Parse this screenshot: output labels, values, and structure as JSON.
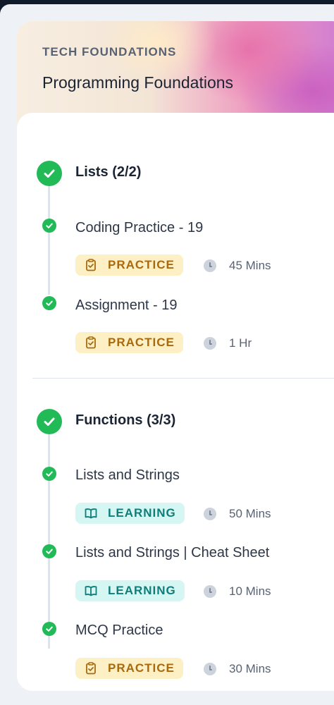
{
  "course": {
    "eyebrow": "TECH FOUNDATIONS",
    "title": "Programming Foundations"
  },
  "sections": [
    {
      "title": "Lists (2/2)",
      "items": [
        {
          "title": "Coding Practice - 19",
          "tag": "PRACTICE",
          "duration": "45 Mins"
        },
        {
          "title": "Assignment - 19",
          "tag": "PRACTICE",
          "duration": "1 Hr"
        }
      ]
    },
    {
      "title": "Functions (3/3)",
      "items": [
        {
          "title": "Lists and Strings",
          "tag": "LEARNING",
          "duration": "50 Mins"
        },
        {
          "title": "Lists and Strings | Cheat Sheet",
          "tag": "LEARNING",
          "duration": "10 Mins"
        },
        {
          "title": "MCQ Practice",
          "tag": "PRACTICE",
          "duration": "30 Mins"
        }
      ]
    }
  ],
  "icons": {
    "completed": "check-circle-icon",
    "practice": "clipboard-check-icon",
    "learning": "open-book-icon",
    "duration": "clock-icon"
  },
  "colors": {
    "completed": "#22b957",
    "practice_bg": "#fdf0c4",
    "practice_text": "#a9690c",
    "learning_bg": "#d6f6f4",
    "learning_text": "#0f7d79"
  }
}
